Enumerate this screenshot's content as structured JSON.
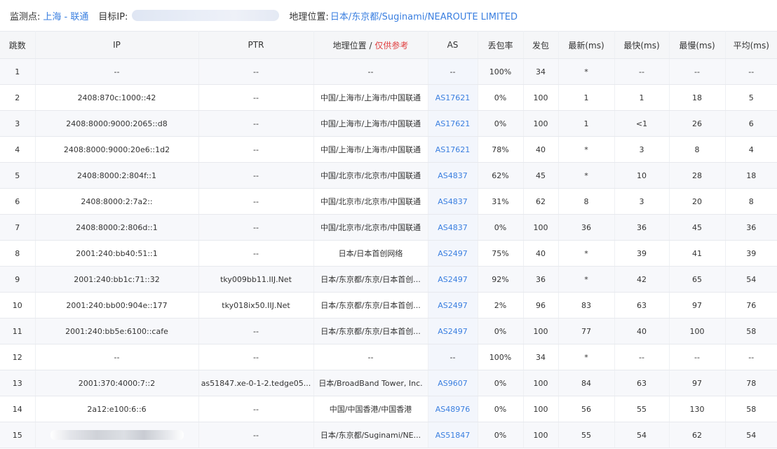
{
  "header": {
    "monitor_label": "监测点:",
    "monitor_value": "上海 - 联通",
    "target_label": "目标IP:",
    "geo_label": "地理位置:",
    "geo_value": "日本/东京都/Suginami/NEAROUTE LIMITED"
  },
  "table": {
    "columns": {
      "hop": "跳数",
      "ip": "IP",
      "ptr": "PTR",
      "geo": "地理位置 /",
      "geo_note": "仅供参考",
      "as": "AS",
      "loss": "丢包率",
      "sent": "发包",
      "last": "最新(ms)",
      "best": "最快(ms)",
      "worst": "最慢(ms)",
      "avg": "平均(ms)"
    },
    "rows": [
      {
        "hop": "1",
        "ip": "--",
        "ptr": "--",
        "geo": "--",
        "as": "--",
        "loss": "100%",
        "sent": "34",
        "last": "*",
        "best": "--",
        "worst": "--",
        "avg": "--"
      },
      {
        "hop": "2",
        "ip": "2408:870c:1000::42",
        "ptr": "--",
        "geo": "中国/上海市/上海市/中国联通",
        "as": "AS17621",
        "loss": "0%",
        "sent": "100",
        "last": "1",
        "best": "1",
        "worst": "18",
        "avg": "5"
      },
      {
        "hop": "3",
        "ip": "2408:8000:9000:2065::d8",
        "ptr": "--",
        "geo": "中国/上海市/上海市/中国联通",
        "as": "AS17621",
        "loss": "0%",
        "sent": "100",
        "last": "1",
        "best": "<1",
        "worst": "26",
        "avg": "6"
      },
      {
        "hop": "4",
        "ip": "2408:8000:9000:20e6::1d2",
        "ptr": "--",
        "geo": "中国/上海市/上海市/中国联通",
        "as": "AS17621",
        "loss": "78%",
        "sent": "40",
        "last": "*",
        "best": "3",
        "worst": "8",
        "avg": "4"
      },
      {
        "hop": "5",
        "ip": "2408:8000:2:804f::1",
        "ptr": "--",
        "geo": "中国/北京市/北京市/中国联通",
        "as": "AS4837",
        "loss": "62%",
        "sent": "45",
        "last": "*",
        "best": "10",
        "worst": "28",
        "avg": "18"
      },
      {
        "hop": "6",
        "ip": "2408:8000:2:7a2::",
        "ptr": "--",
        "geo": "中国/北京市/北京市/中国联通",
        "as": "AS4837",
        "loss": "31%",
        "sent": "62",
        "last": "8",
        "best": "3",
        "worst": "20",
        "avg": "8"
      },
      {
        "hop": "7",
        "ip": "2408:8000:2:806d::1",
        "ptr": "--",
        "geo": "中国/北京市/北京市/中国联通",
        "as": "AS4837",
        "loss": "0%",
        "sent": "100",
        "last": "36",
        "best": "36",
        "worst": "45",
        "avg": "36"
      },
      {
        "hop": "8",
        "ip": "2001:240:bb40:51::1",
        "ptr": "--",
        "geo": "日本/日本首创网络",
        "as": "AS2497",
        "loss": "75%",
        "sent": "40",
        "last": "*",
        "best": "39",
        "worst": "41",
        "avg": "39"
      },
      {
        "hop": "9",
        "ip": "2001:240:bb1c:71::32",
        "ptr": "tky009bb11.IIJ.Net",
        "geo": "日本/东京都/东京/日本首创...",
        "as": "AS2497",
        "loss": "92%",
        "sent": "36",
        "last": "*",
        "best": "42",
        "worst": "65",
        "avg": "54"
      },
      {
        "hop": "10",
        "ip": "2001:240:bb00:904e::177",
        "ptr": "tky018ix50.IIJ.Net",
        "geo": "日本/东京都/东京/日本首创...",
        "as": "AS2497",
        "loss": "2%",
        "sent": "96",
        "last": "83",
        "best": "63",
        "worst": "97",
        "avg": "76"
      },
      {
        "hop": "11",
        "ip": "2001:240:bb5e:6100::cafe",
        "ptr": "--",
        "geo": "日本/东京都/东京/日本首创...",
        "as": "AS2497",
        "loss": "0%",
        "sent": "100",
        "last": "77",
        "best": "40",
        "worst": "100",
        "avg": "58"
      },
      {
        "hop": "12",
        "ip": "--",
        "ptr": "--",
        "geo": "--",
        "as": "--",
        "loss": "100%",
        "sent": "34",
        "last": "*",
        "best": "--",
        "worst": "--",
        "avg": "--"
      },
      {
        "hop": "13",
        "ip": "2001:370:4000:7::2",
        "ptr": "as51847.xe-0-1-2.tedge05...",
        "geo": "日本/BroadBand Tower, Inc.",
        "as": "AS9607",
        "loss": "0%",
        "sent": "100",
        "last": "84",
        "best": "63",
        "worst": "97",
        "avg": "78"
      },
      {
        "hop": "14",
        "ip": "2a12:e100:6::6",
        "ptr": "--",
        "geo": "中国/中国香港/中国香港",
        "as": "AS48976",
        "loss": "0%",
        "sent": "100",
        "last": "56",
        "best": "55",
        "worst": "130",
        "avg": "58"
      },
      {
        "hop": "15",
        "ip": "",
        "ptr": "--",
        "geo": "日本/东京都/Suginami/NE...",
        "as": "AS51847",
        "loss": "0%",
        "sent": "100",
        "last": "55",
        "best": "54",
        "worst": "62",
        "avg": "54"
      }
    ]
  }
}
